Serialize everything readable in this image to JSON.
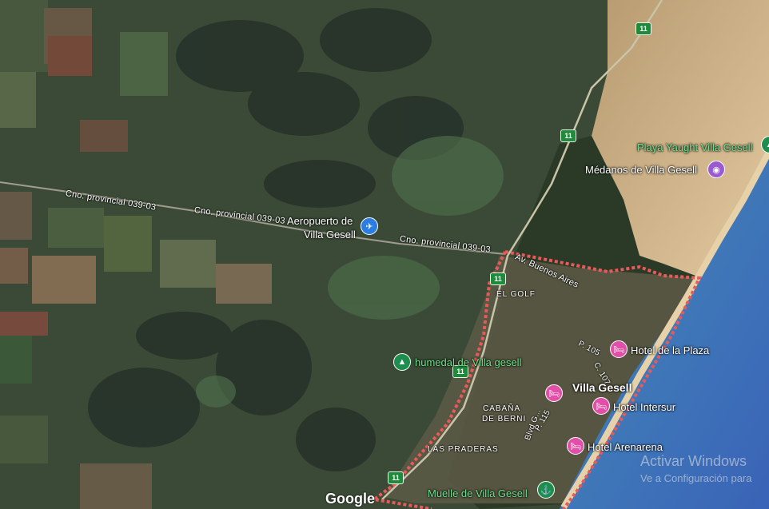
{
  "map": {
    "roads": {
      "cno_1": "Cno. provincial 039-03",
      "cno_2": "Cno. provincial 039-03",
      "cno_3": "Cno. provincial 039-03",
      "av_buenos_aires": "Av. Buenos Aires",
      "street_105": "P. 105",
      "street_107": "C. 107",
      "street_115": "P. 115",
      "blvd": "Blvd G..."
    },
    "route_shields": [
      "11",
      "11",
      "11",
      "11",
      "11"
    ],
    "districts": {
      "el_golf": "EL GOLF",
      "cabana": "CABAÑA",
      "de_berni": "DE BERNI",
      "las_praderas": "LAS PRADERAS"
    },
    "city": "Villa Gesell",
    "pois": {
      "airport_line1": "Aeropuerto de",
      "airport_line2": "Villa Gesell",
      "playa": "Playa Yaught Villa Gesell",
      "medanos": "Médanos de Villa Gesell",
      "humedal": "humedal de Villa gesell",
      "hotel_plaza": "Hotel de la Plaza",
      "hotel_intersur": "Hotel Intersur",
      "hotel_arenarena": "Hotel Arenarena",
      "muelle": "Muelle de Villa Gesell"
    },
    "icons": {
      "airport": "✈",
      "hotel": "🛏",
      "camera": "◉",
      "park": "▲",
      "dock": "⚓"
    },
    "attribution": "Google",
    "colors": {
      "boundary": "#e85a5a",
      "route_shield": "#1f8a3a",
      "hotel_marker": "#e04fa8",
      "airport_marker": "#2a7de1",
      "park_marker": "#1e8e4e",
      "poi_green_text": "#6fe08c"
    }
  },
  "overlay": {
    "activate_title": "Activar Windows",
    "activate_sub": "Ve a Configuración para"
  }
}
